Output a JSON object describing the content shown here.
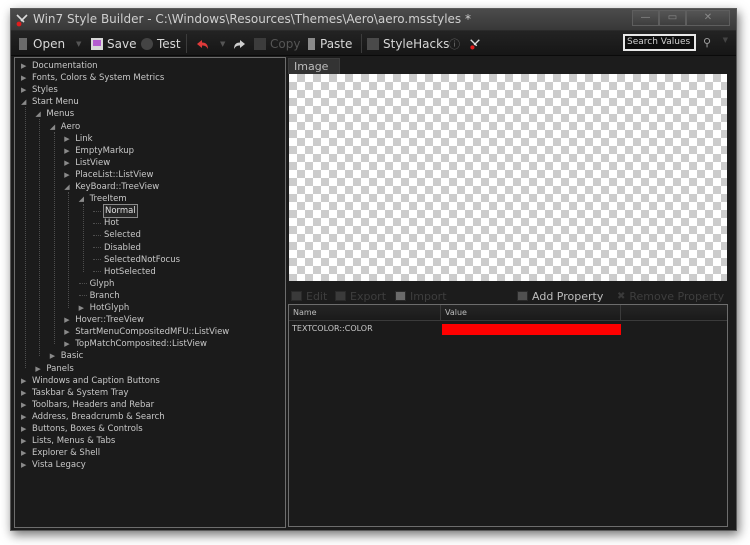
{
  "window": {
    "title": "Win7 Style Builder - C:\\Windows\\Resources\\Themes\\Aero\\aero.msstyles *",
    "caption_buttons": [
      {
        "name": "minimize",
        "glyph": "—"
      },
      {
        "name": "maximize",
        "glyph": "▭"
      },
      {
        "name": "close",
        "glyph": "✕"
      }
    ]
  },
  "toolbar": {
    "open": "Open",
    "save": "Save",
    "test": "Test",
    "undo_icon": "undo-icon",
    "redo_icon": "redo-icon",
    "copy": "Copy",
    "paste": "Paste",
    "stylehacks": "StyleHacks",
    "info_glyph": "ⓘ",
    "search_placeholder": "Search Values",
    "search_glyph": "⚲",
    "dropdown_glyph": "▼"
  },
  "tree": {
    "collapsed_glyph": "▶",
    "expanded_glyph": "◢",
    "items": [
      {
        "label": "Documentation",
        "level": 0,
        "state": "collapsed"
      },
      {
        "label": "Fonts, Colors & System Metrics",
        "level": 0,
        "state": "collapsed"
      },
      {
        "label": "Styles",
        "level": 0,
        "state": "collapsed"
      },
      {
        "label": "Start Menu",
        "level": 0,
        "state": "expanded"
      },
      {
        "label": "Menus",
        "level": 1,
        "state": "expanded"
      },
      {
        "label": "Aero",
        "level": 2,
        "state": "expanded"
      },
      {
        "label": "Link",
        "level": 3,
        "state": "collapsed"
      },
      {
        "label": "EmptyMarkup",
        "level": 3,
        "state": "collapsed"
      },
      {
        "label": "ListView",
        "level": 3,
        "state": "collapsed"
      },
      {
        "label": "PlaceList::ListView",
        "level": 3,
        "state": "collapsed"
      },
      {
        "label": "KeyBoard::TreeView",
        "level": 3,
        "state": "expanded"
      },
      {
        "label": "TreeItem",
        "level": 4,
        "state": "expanded"
      },
      {
        "label": "Normal",
        "level": 5,
        "state": "leaf",
        "selected": true
      },
      {
        "label": "Hot",
        "level": 5,
        "state": "leaf"
      },
      {
        "label": "Selected",
        "level": 5,
        "state": "leaf"
      },
      {
        "label": "Disabled",
        "level": 5,
        "state": "leaf"
      },
      {
        "label": "SelectedNotFocus",
        "level": 5,
        "state": "leaf"
      },
      {
        "label": "HotSelected",
        "level": 5,
        "state": "leaf"
      },
      {
        "label": "Glyph",
        "level": 4,
        "state": "leaf"
      },
      {
        "label": "Branch",
        "level": 4,
        "state": "leaf"
      },
      {
        "label": "HotGlyph",
        "level": 4,
        "state": "collapsed"
      },
      {
        "label": "Hover::TreeView",
        "level": 3,
        "state": "collapsed"
      },
      {
        "label": "StartMenuCompositedMFU::ListView",
        "level": 3,
        "state": "collapsed"
      },
      {
        "label": "TopMatchComposited::ListView",
        "level": 3,
        "state": "collapsed"
      },
      {
        "label": "Basic",
        "level": 2,
        "state": "collapsed"
      },
      {
        "label": "Panels",
        "level": 1,
        "state": "collapsed"
      },
      {
        "label": "Windows and Caption Buttons",
        "level": 0,
        "state": "collapsed"
      },
      {
        "label": "Taskbar & System Tray",
        "level": 0,
        "state": "collapsed"
      },
      {
        "label": "Toolbars, Headers and Rebar",
        "level": 0,
        "state": "collapsed"
      },
      {
        "label": "Address, Breadcrumb & Search",
        "level": 0,
        "state": "collapsed"
      },
      {
        "label": "Buttons, Boxes & Controls",
        "level": 0,
        "state": "collapsed"
      },
      {
        "label": "Lists, Menus & Tabs",
        "level": 0,
        "state": "collapsed"
      },
      {
        "label": "Explorer & Shell",
        "level": 0,
        "state": "collapsed"
      },
      {
        "label": "Vista Legacy",
        "level": 0,
        "state": "collapsed"
      }
    ]
  },
  "preview": {
    "tab_label": "Image"
  },
  "properties": {
    "toolbar": {
      "edit": "Edit",
      "export": "Export",
      "import": "Import",
      "add": "Add Property",
      "remove": "Remove Property"
    },
    "columns": [
      "Name",
      "Value",
      ""
    ],
    "rows": [
      {
        "name": "TEXTCOLOR::COLOR",
        "value_color": "#ff0000"
      }
    ]
  },
  "colors": {
    "accent_red": "#ff0000",
    "save_icon": "#b45bd0",
    "undo_icon": "#e03a3a"
  }
}
